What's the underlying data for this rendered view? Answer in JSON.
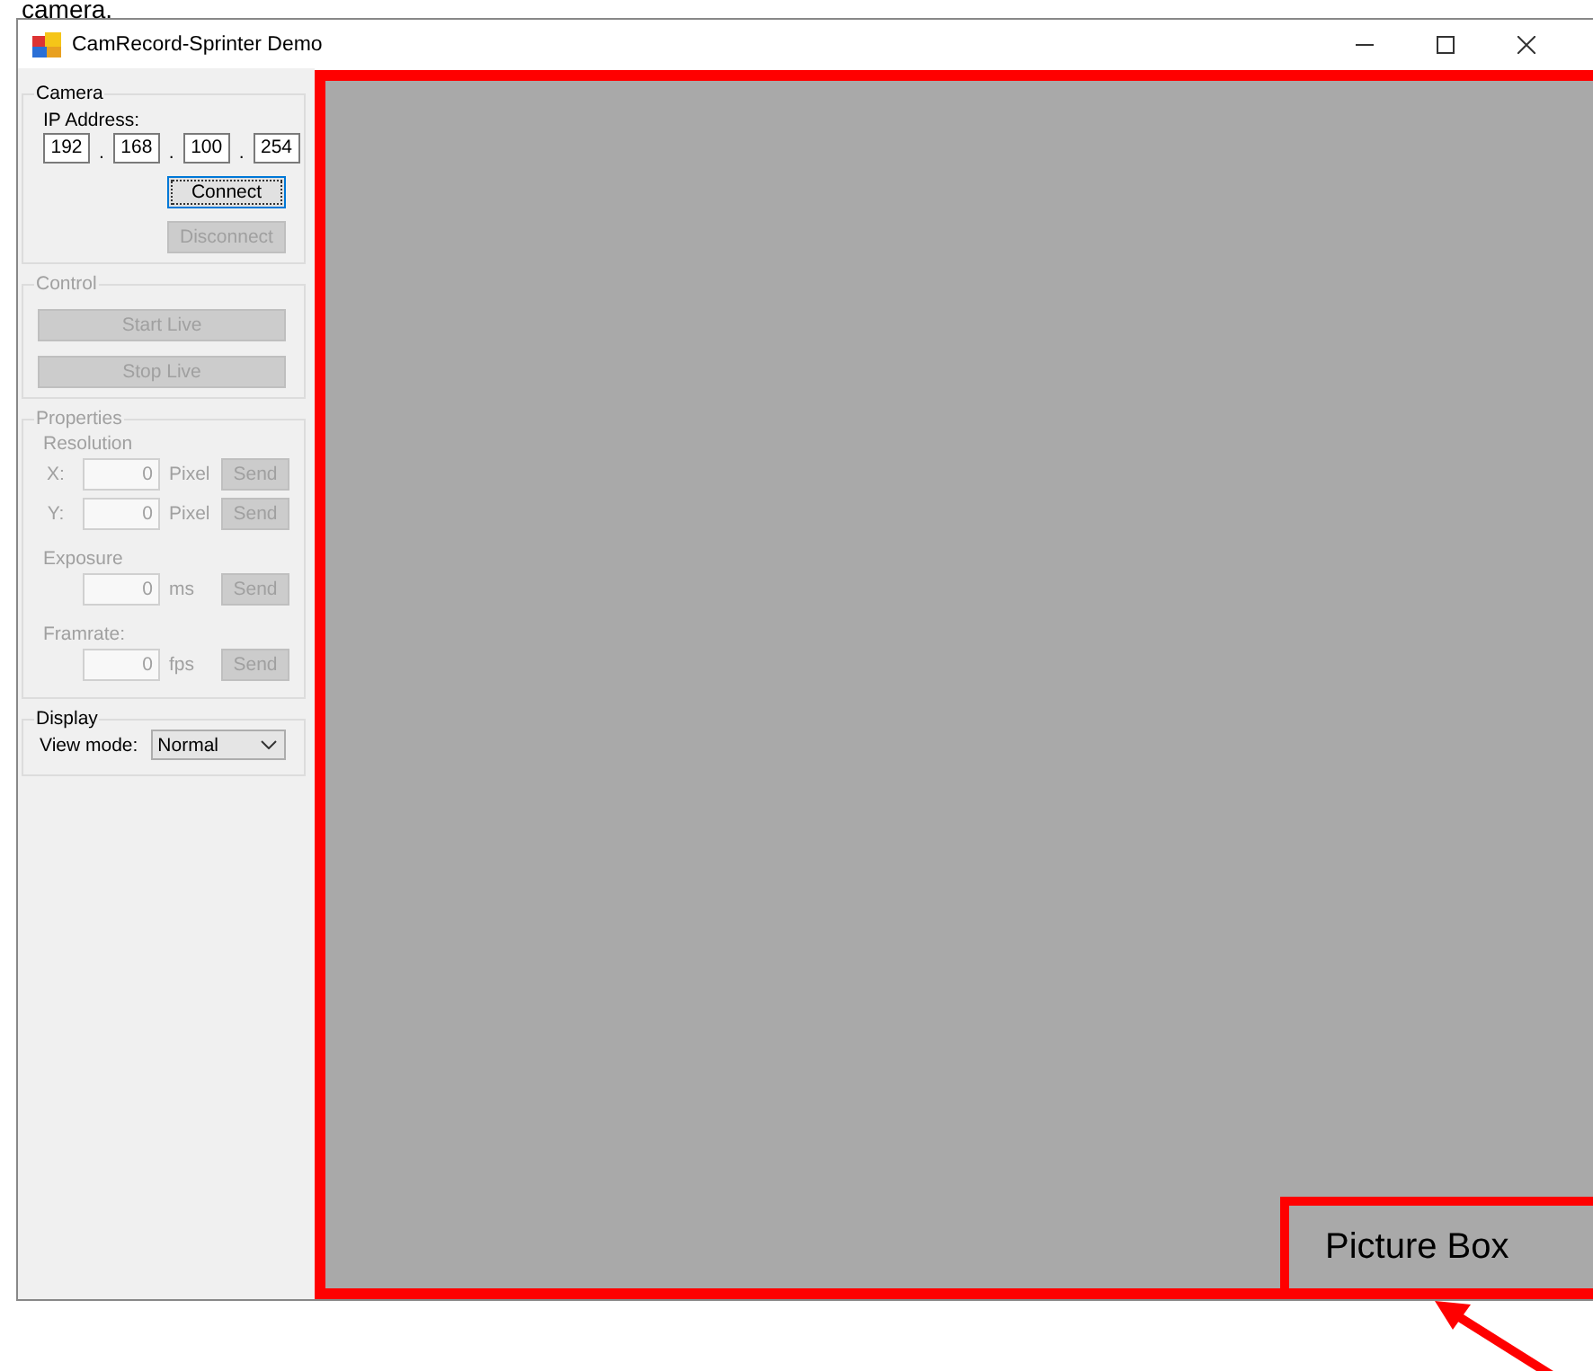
{
  "document_text": "camera.",
  "window": {
    "title": "CamRecord-Sprinter Demo"
  },
  "camera_group": {
    "title": "Camera",
    "ip_label": "IP Address:",
    "ip_octets": [
      "192",
      "168",
      "100",
      "254"
    ],
    "separators": [
      ".",
      ".",
      "."
    ],
    "buttons": [
      {
        "label": "Connect",
        "disabled": false,
        "focused": true
      },
      {
        "label": "Disconnect",
        "disabled": true,
        "focused": false
      }
    ]
  },
  "control_group": {
    "title": "Control",
    "disabled": true,
    "buttons": [
      {
        "label": "Start Live",
        "disabled": true
      },
      {
        "label": "Stop Live",
        "disabled": true
      }
    ]
  },
  "properties_group": {
    "title": "Properties",
    "disabled": true,
    "sections": [
      {
        "label": "Resolution",
        "rows": [
          {
            "axis": "X:",
            "value": "0",
            "unit": "Pixel",
            "button": "Send"
          },
          {
            "axis": "Y:",
            "value": "0",
            "unit": "Pixel",
            "button": "Send"
          }
        ]
      },
      {
        "label": "Exposure",
        "rows": [
          {
            "value": "0",
            "unit": "ms",
            "button": "Send"
          }
        ]
      },
      {
        "label": "Framrate:",
        "rows": [
          {
            "value": "0",
            "unit": "fps",
            "button": "Send"
          }
        ]
      }
    ]
  },
  "display_group": {
    "title": "Display",
    "view_mode_label": "View mode:",
    "view_mode": "Normal",
    "disabled": false
  },
  "picture_box": {
    "annotation": "Picture Box"
  }
}
